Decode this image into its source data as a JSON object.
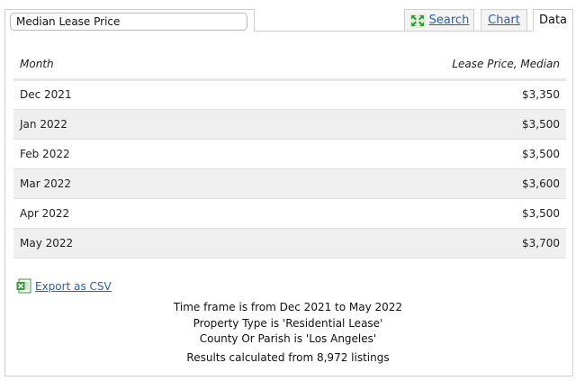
{
  "header": {
    "title_value": "Median Lease Price"
  },
  "tabs": {
    "search": "Search",
    "chart": "Chart",
    "data": "Data",
    "active": "Data"
  },
  "table": {
    "columns": [
      "Month",
      "Lease Price, Median"
    ],
    "rows": [
      {
        "month": "Dec 2021",
        "price": "$3,350"
      },
      {
        "month": "Jan 2022",
        "price": "$3,500"
      },
      {
        "month": "Feb 2022",
        "price": "$3,500"
      },
      {
        "month": "Mar 2022",
        "price": "$3,600"
      },
      {
        "month": "Apr 2022",
        "price": "$3,500"
      },
      {
        "month": "May 2022",
        "price": "$3,700"
      }
    ]
  },
  "export": {
    "label": "Export as CSV"
  },
  "info": {
    "timeframe": "Time frame is from Dec 2021 to May 2022",
    "property_type": "Property Type is 'Residential Lease'",
    "county": "County Or Parish is 'Los Angeles'",
    "results": "Results calculated from 8,972 listings"
  },
  "colors": {
    "link": "#2a5db0",
    "row_alt": "#efefef",
    "border": "#d0d0d0",
    "icon_green": "#3a9a3a"
  }
}
